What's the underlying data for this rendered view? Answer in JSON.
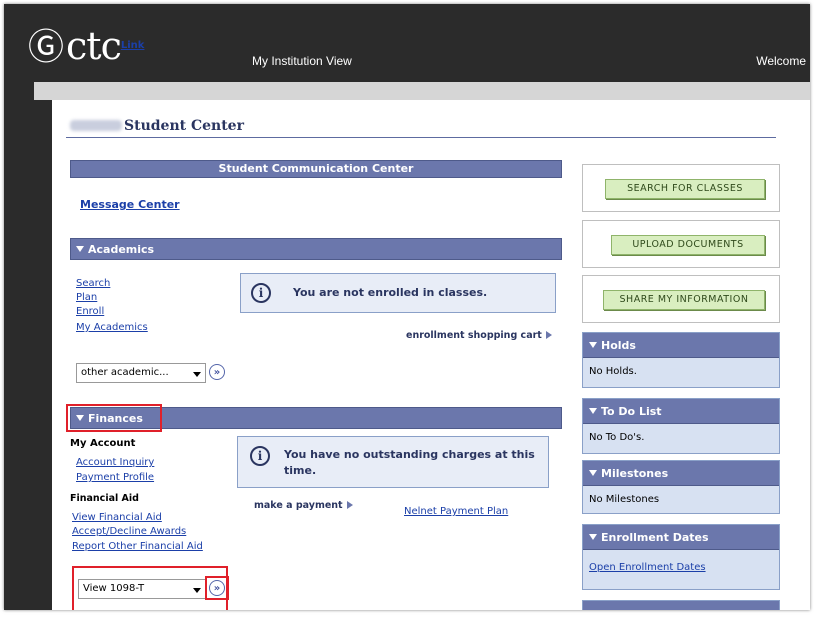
{
  "banner": {
    "logo_mark": "Ⓖ",
    "logo_ctc": "ctc",
    "logo_link": "Link",
    "institution_view": "My Institution View",
    "welcome": "Welcome"
  },
  "page": {
    "title_suffix": "Student Center"
  },
  "communication": {
    "header": "Student Communication Center",
    "message_center": "Message Center"
  },
  "academics": {
    "header": "Academics",
    "links": [
      "Search",
      "Plan",
      "Enroll",
      "My Academics"
    ],
    "notice": "You are not enrolled in classes.",
    "shopping_cart": "enrollment shopping cart",
    "dropdown_value": "other academic..."
  },
  "finances": {
    "header": "Finances",
    "my_account_label": "My Account",
    "account_links": [
      "Account Inquiry",
      "Payment Profile"
    ],
    "financial_aid_label": "Financial Aid",
    "aid_links": [
      "View Financial Aid",
      "Accept/Decline Awards",
      "Report Other Financial Aid"
    ],
    "notice": "You have no outstanding charges at this time.",
    "make_payment": "make a payment",
    "payment_plan": "Nelnet Payment Plan",
    "dropdown_value": "View 1098-T"
  },
  "sidebar": {
    "buttons": [
      "Search For Classes",
      "Upload Documents",
      "Share My Information"
    ],
    "holds": {
      "header": "Holds",
      "body": "No Holds."
    },
    "todo": {
      "header": "To Do List",
      "body": "No To Do's."
    },
    "milestones": {
      "header": "Milestones",
      "body": "No Milestones"
    },
    "enrollment_dates": {
      "header": "Enrollment Dates",
      "link": "Open Enrollment Dates"
    }
  },
  "icons": {
    "info": "i",
    "go": "»"
  },
  "colors": {
    "header_bar": "#6b77ac",
    "button_green": "#d9eec0",
    "highlight_red": "#e0202a",
    "link_blue": "#1b3fa8"
  }
}
